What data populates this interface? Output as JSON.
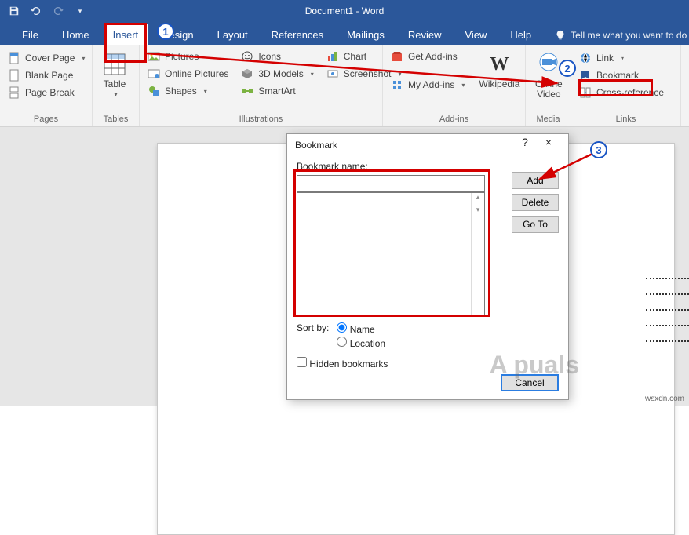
{
  "title": "Document1 - Word",
  "tabs": {
    "file": "File",
    "home": "Home",
    "insert": "Insert",
    "design": "Design",
    "layout": "Layout",
    "references": "References",
    "mailings": "Mailings",
    "review": "Review",
    "view": "View",
    "help": "Help",
    "tellme": "Tell me what you want to do"
  },
  "groups": {
    "pages": {
      "label": "Pages",
      "cover": "Cover Page",
      "blank": "Blank Page",
      "break": "Page Break"
    },
    "tables": {
      "label": "Tables",
      "table": "Table"
    },
    "illus": {
      "label": "Illustrations",
      "pictures": "Pictures",
      "online": "Online Pictures",
      "shapes": "Shapes",
      "icons": "Icons",
      "models": "3D Models",
      "smartart": "SmartArt",
      "chart": "Chart",
      "screenshot": "Screenshot"
    },
    "addins": {
      "label": "Add-ins",
      "get": "Get Add-ins",
      "my": "My Add-ins",
      "wiki": "Wikipedia"
    },
    "media": {
      "label": "Media",
      "video": "Online\nVideo"
    },
    "links": {
      "label": "Links",
      "link": "Link",
      "bookmark": "Bookmark",
      "xref": "Cross-reference"
    }
  },
  "dialog": {
    "title": "Bookmark",
    "help": "?",
    "close": "×",
    "name_label": "Bookmark name:",
    "name_value": "",
    "add": "Add",
    "delete": "Delete",
    "goto": "Go To",
    "sortby": "Sort by:",
    "opt_name": "Name",
    "opt_loc": "Location",
    "hidden": "Hidden bookmarks",
    "cancel": "Cancel"
  },
  "badges": {
    "one": "1",
    "two": "2",
    "three": "3"
  },
  "watermark": "A   puals",
  "credit": "wsxdn.com"
}
